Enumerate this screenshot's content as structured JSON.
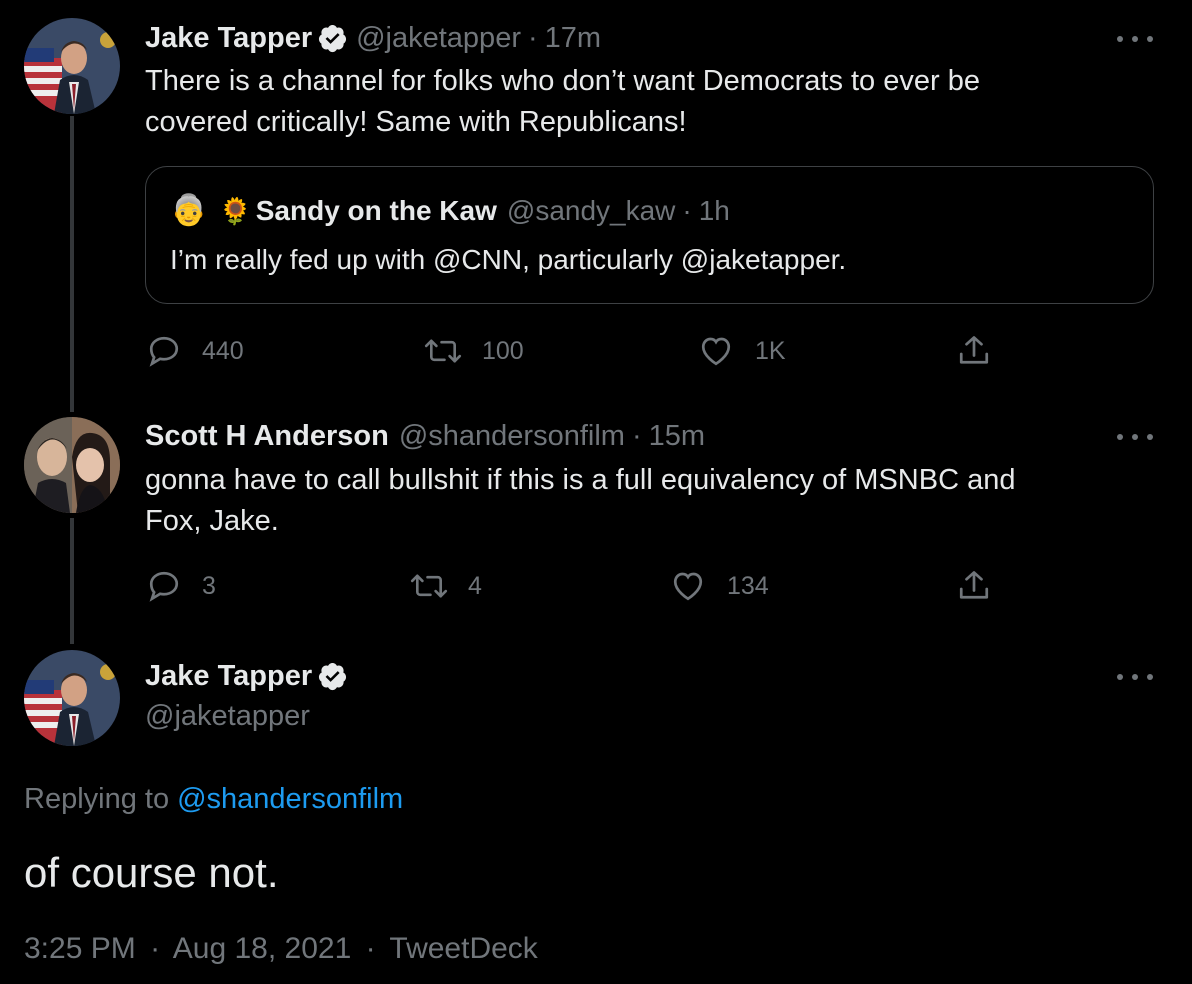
{
  "colors": {
    "background": "#000000",
    "text": "#e7e9ea",
    "muted": "#71767b",
    "link": "#1d9bf0",
    "border": "#3e4144"
  },
  "tweet1": {
    "name": "Jake Tapper",
    "handle": "@jaketapper",
    "separator": "·",
    "time": "17m",
    "text_line1": "There is a channel for folks who don’t want Democrats to ever be",
    "text_line2": "covered critically! Same with Republicans!",
    "quote": {
      "emoji_avatar": "👵",
      "emoji_flower": "🌻",
      "name": "Sandy on the Kaw",
      "handle": "@sandy_kaw",
      "separator": "·",
      "time": "1h",
      "text": "I’m really fed up with @CNN, particularly @jaketapper."
    },
    "actions": {
      "replies": "440",
      "retweets": "100",
      "likes": "1K"
    }
  },
  "tweet2": {
    "name": "Scott H Anderson",
    "handle": "@shandersonfilm",
    "separator": "·",
    "time": "15m",
    "text_line1": "gonna have to call bullshit if this is a full equivalency of MSNBC and",
    "text_line2": "Fox, Jake.",
    "actions": {
      "replies": "3",
      "retweets": "4",
      "likes": "134"
    }
  },
  "main_tweet": {
    "name": "Jake Tapper",
    "handle": "@jaketapper",
    "replying_to_label": "Replying to",
    "replying_to_handle": "@shandersonfilm",
    "text": "of course not.",
    "time": "3:25 PM",
    "separator1": "·",
    "date": "Aug 18, 2021",
    "separator2": "·",
    "source": "TweetDeck"
  },
  "icons": [
    "verified-badge-icon",
    "more-options-icon",
    "reply-icon",
    "retweet-icon",
    "like-icon",
    "share-icon"
  ]
}
